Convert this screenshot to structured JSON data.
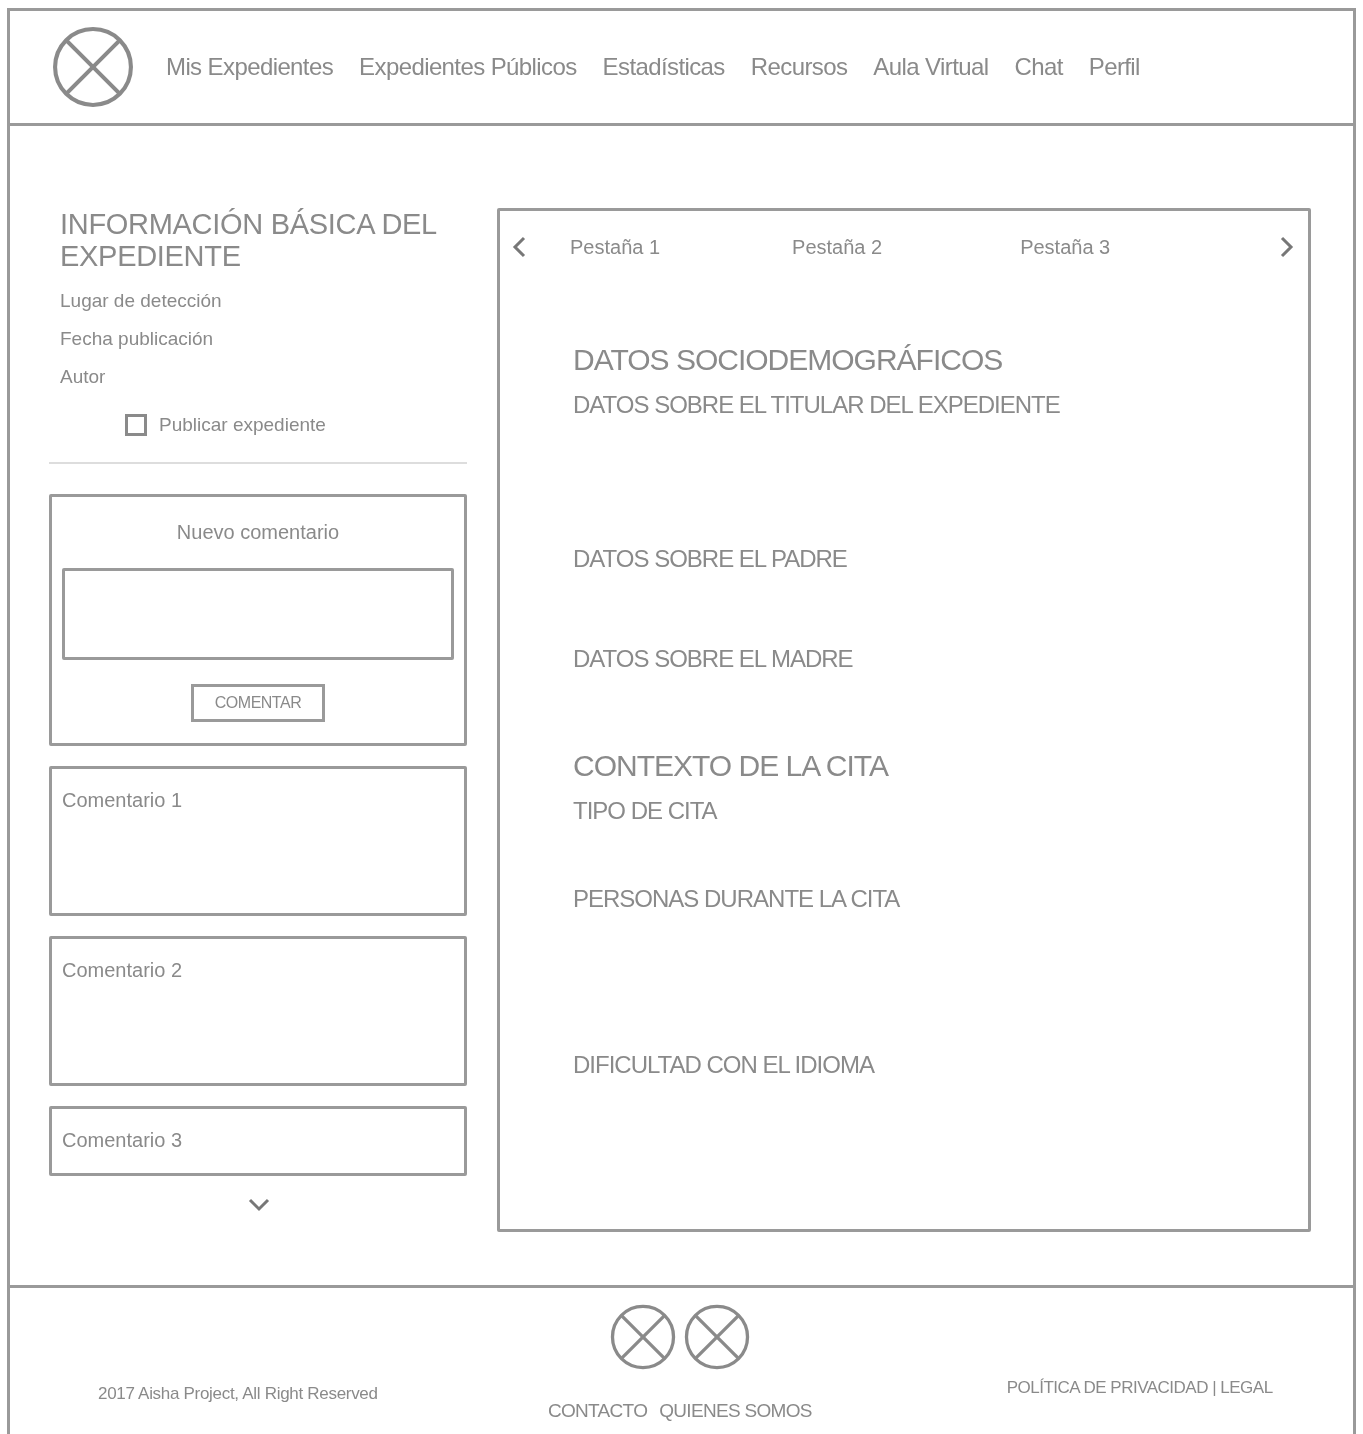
{
  "nav": {
    "items": [
      "Mis Expedientes",
      "Expedientes Públicos",
      "Estadísticas",
      "Recursos",
      "Aula Virtual",
      "Chat",
      "Perfil"
    ]
  },
  "info": {
    "title": "INFORMACIÓN BÁSICA DEL EXPEDIENTE",
    "fields": [
      "Lugar de detección",
      "Fecha publicación",
      "Autor"
    ],
    "publish": {
      "label": "Publicar expediente",
      "checked": false
    }
  },
  "new_comment": {
    "title": "Nuevo comentario",
    "button": "COMENTAR"
  },
  "comments": [
    "Comentario 1",
    "Comentario 2",
    "Comentario 3"
  ],
  "tabs": [
    {
      "label": "Pestaña 1",
      "selected": false
    },
    {
      "label": "Pestaña 2",
      "selected": false
    },
    {
      "label": "Pestaña 3",
      "selected": false
    }
  ],
  "sections": [
    {
      "kind": "heading",
      "text": "DATOS SOCIODEMOGRÁFICOS"
    },
    {
      "kind": "subheading",
      "text": "DATOS SOBRE EL TITULAR DEL EXPEDIENTE"
    },
    {
      "kind": "subheading",
      "text": "DATOS SOBRE EL PADRE"
    },
    {
      "kind": "subheading",
      "text": "DATOS SOBRE EL MADRE"
    },
    {
      "kind": "heading",
      "text": "CONTEXTO DE LA CITA"
    },
    {
      "kind": "subheading",
      "text": "TIPO DE CITA"
    },
    {
      "kind": "subheading",
      "text": "PERSONAS DURANTE LA CITA"
    },
    {
      "kind": "subheading",
      "text": "DIFICULTAD CON EL IDIOMA"
    }
  ],
  "footer": {
    "copyright": "2017 Aisha Project, All Right Reserved",
    "links": [
      "CONTACTO",
      "QUIENES SOMOS"
    ],
    "legal": "POLÍTICA DE PRIVACIDAD | LEGAL"
  }
}
